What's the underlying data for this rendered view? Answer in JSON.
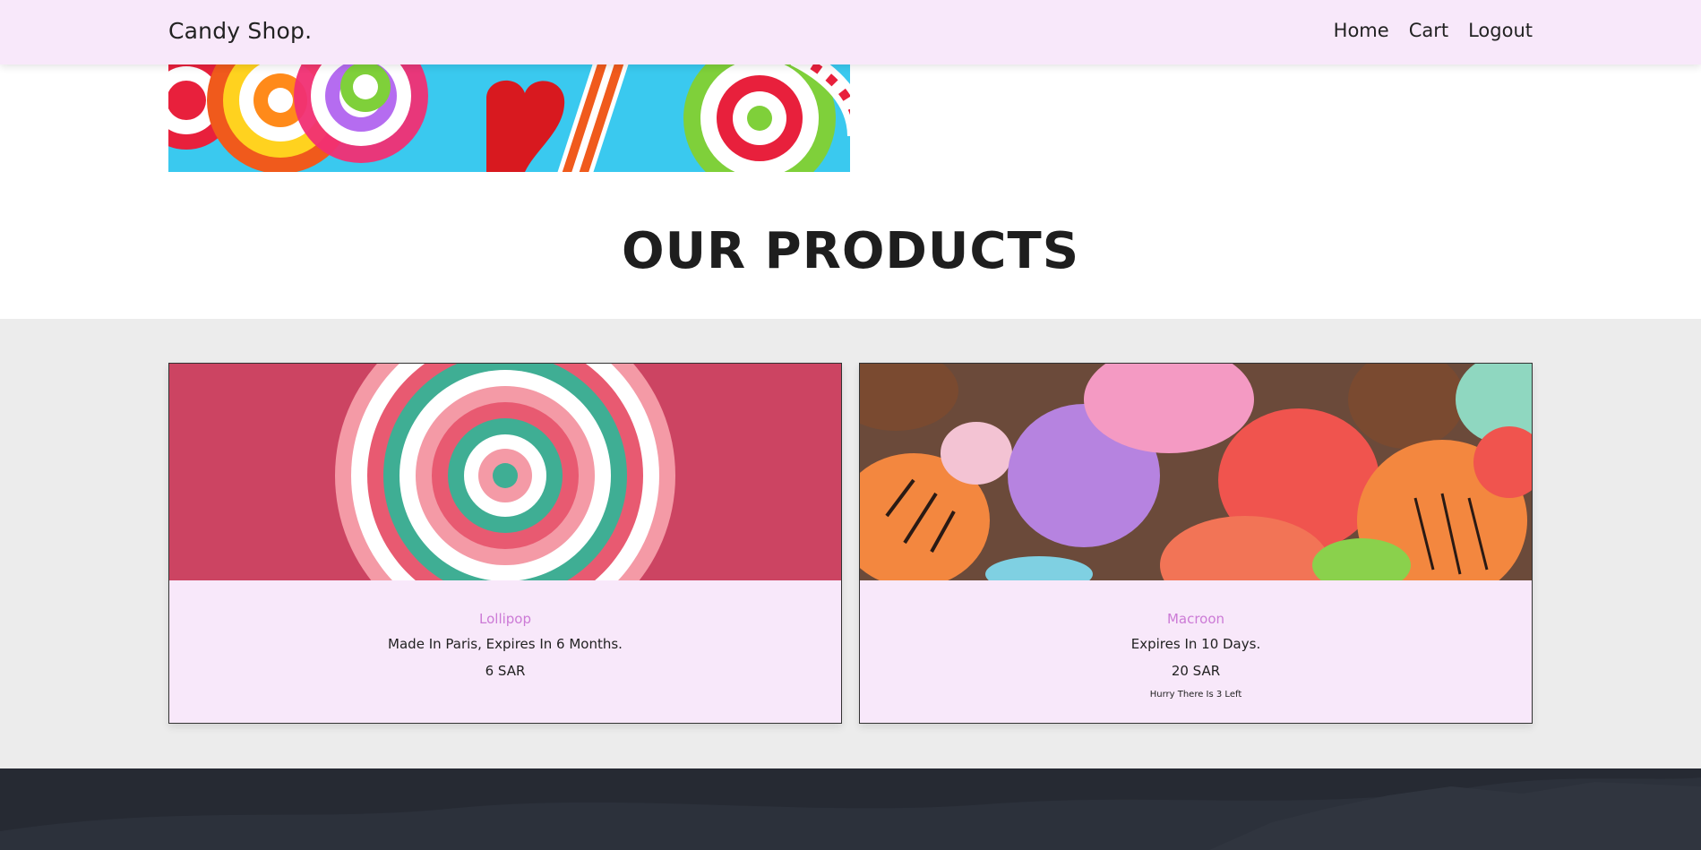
{
  "header": {
    "brand": "Candy Shop.",
    "nav": [
      "Home",
      "Cart",
      "Logout"
    ]
  },
  "section": {
    "title": "OUR PRODUCTS"
  },
  "products": [
    {
      "name": "Lollipop",
      "description": "Made In Paris, Expires In 6 Months.",
      "price": "6 SAR",
      "stock_note": ""
    },
    {
      "name": "Macroon",
      "description": "Expires In 10 Days.",
      "price": "20 SAR",
      "stock_note": "Hurry There Is 3 Left"
    }
  ],
  "colors": {
    "navbar_bg": "#f8e8fa",
    "accent_name": "#cc7ad6",
    "products_bg": "#ececec",
    "footer_bg": "#262a33"
  },
  "icons": {
    "hero": "candy-banner-image",
    "lollipop": "lollipop-image",
    "macaron": "macaron-image"
  }
}
